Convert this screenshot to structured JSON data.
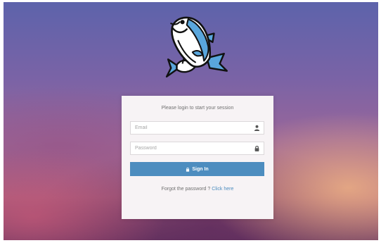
{
  "login": {
    "message": "Please login to start your session",
    "email": {
      "placeholder": "Email",
      "value": "",
      "icon": "user-icon"
    },
    "password": {
      "placeholder": "Password",
      "value": "",
      "icon": "lock-icon"
    },
    "signin_label": "Sign In",
    "signin_icon": "lock-icon",
    "forgot_text": "Forgot the password ?",
    "click_here": "Click here"
  },
  "logo": {
    "icon": "fish-logo-icon"
  },
  "colors": {
    "accent": "#4d8dbf",
    "panel_bg": "#f7f3f5",
    "text_muted": "#707070",
    "background_top": "#5d63ab",
    "background_bottom": "#a9607f"
  }
}
